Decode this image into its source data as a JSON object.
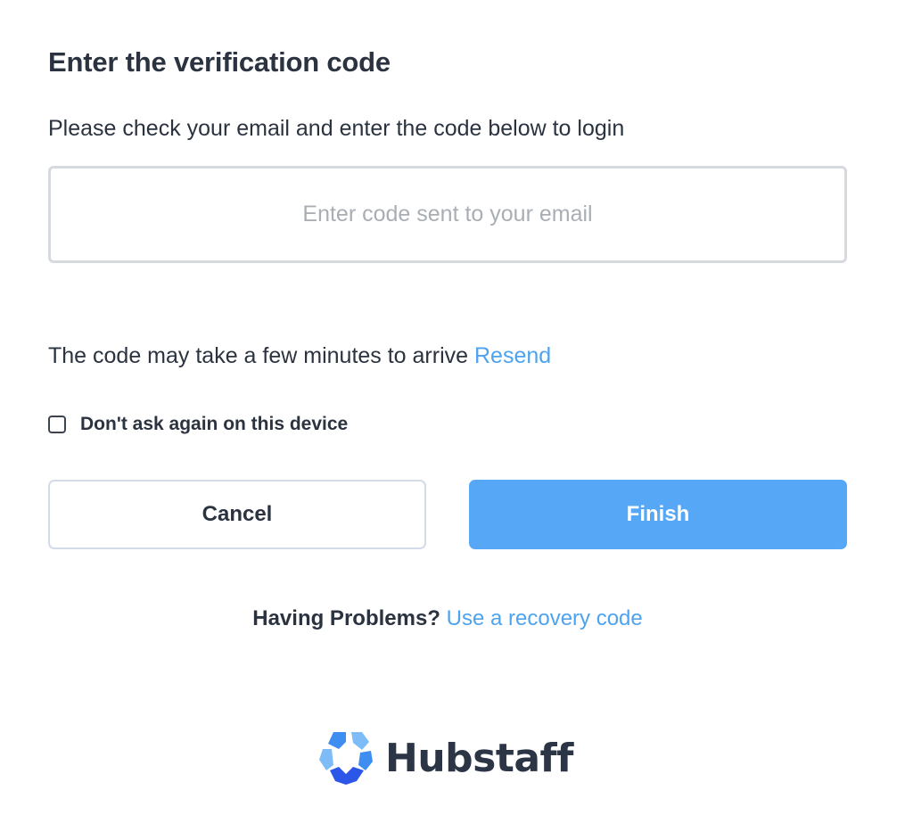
{
  "dialog": {
    "title": "Enter the verification code",
    "subtitle": "Please check your email and enter the code below to login"
  },
  "code_input": {
    "value": "",
    "placeholder": "Enter code sent to your email"
  },
  "hint": {
    "text": "The code may take a few minutes to arrive",
    "resend_label": "Resend"
  },
  "remember": {
    "label": "Don't ask again on this device",
    "checked": false
  },
  "buttons": {
    "cancel_label": "Cancel",
    "finish_label": "Finish"
  },
  "problems": {
    "label": "Having Problems?",
    "recovery_link": "Use a recovery code"
  },
  "brand": {
    "name": "Hubstaff",
    "logo_icon": "hubstaff-logo-icon"
  },
  "colors": {
    "accent": "#56a7f5",
    "link": "#4ea3ef",
    "text": "#2b3340",
    "placeholder": "#a9aeb5",
    "border": "#d6dadf"
  }
}
